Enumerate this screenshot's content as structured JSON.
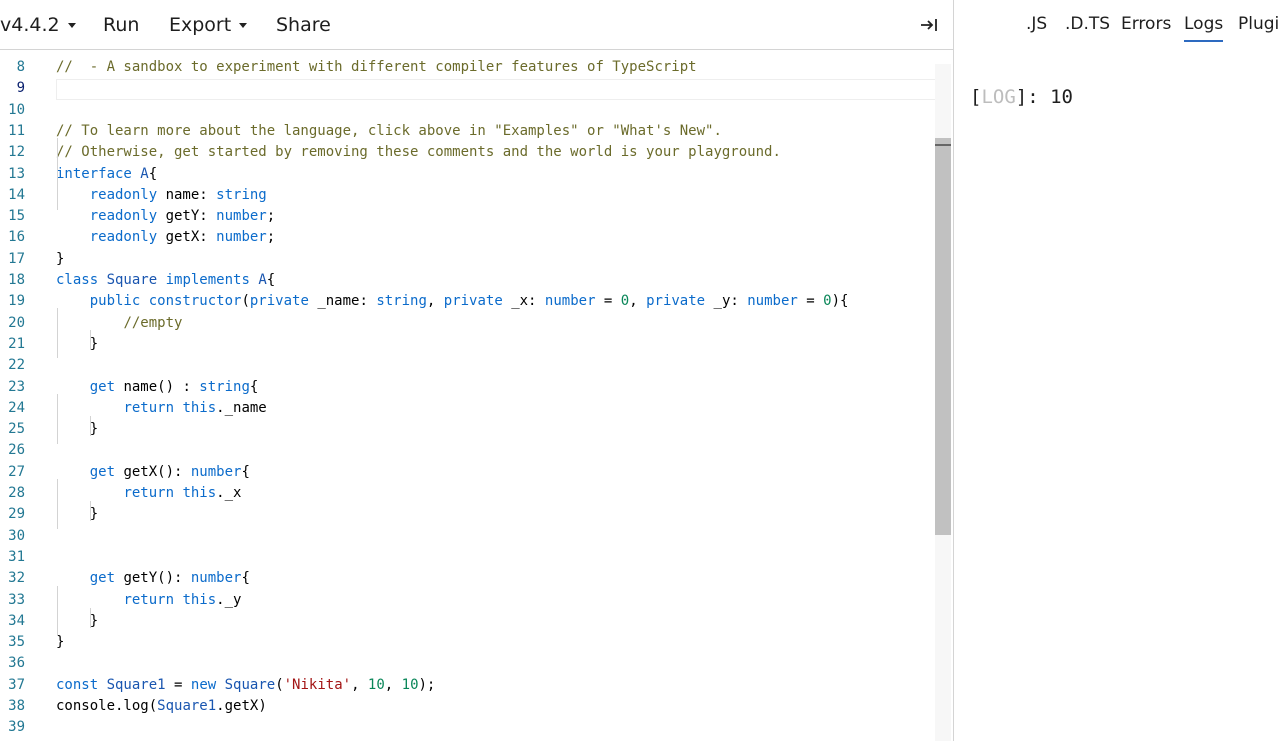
{
  "toolbar": {
    "version_label": "v4.4.2",
    "run_label": "Run",
    "export_label": "Export",
    "share_label": "Share",
    "collapse_icon": "→|"
  },
  "right_panel": {
    "tabs": [
      ".JS",
      ".D.TS",
      "Errors",
      "Logs",
      "Plugin"
    ],
    "active_tab": "Logs",
    "log": {
      "bracket_open": "[",
      "tag": "LOG",
      "bracket_close": "]",
      "value": ": 10"
    }
  },
  "editor": {
    "active_line": 9,
    "lines": [
      {
        "n": "8",
        "segs": [
          [
            "com",
            "//  - A sandbox to experiment with different compiler features of TypeScript"
          ]
        ]
      },
      {
        "n": "9",
        "segs": []
      },
      {
        "n": "10",
        "segs": []
      },
      {
        "n": "11",
        "segs": [
          [
            "com",
            "// To learn more about the language, click above in \"Examples\" or \"What's New\"."
          ]
        ]
      },
      {
        "n": "12",
        "segs": [
          [
            "com",
            "// Otherwise, get started by removing these comments and the world is your playground."
          ]
        ]
      },
      {
        "n": "13",
        "segs": [
          [
            "kw",
            "interface "
          ],
          [
            "typ",
            "A"
          ],
          [
            "fn",
            "{"
          ]
        ]
      },
      {
        "n": "14",
        "segs": [
          [
            "fn",
            "    "
          ],
          [
            "kw",
            "readonly "
          ],
          [
            "fn",
            "name: "
          ],
          [
            "kw",
            "string"
          ]
        ]
      },
      {
        "n": "15",
        "segs": [
          [
            "fn",
            "    "
          ],
          [
            "kw",
            "readonly "
          ],
          [
            "fn",
            "getY: "
          ],
          [
            "kw",
            "number"
          ],
          [
            "fn",
            ";"
          ]
        ]
      },
      {
        "n": "16",
        "segs": [
          [
            "fn",
            "    "
          ],
          [
            "kw",
            "readonly "
          ],
          [
            "fn",
            "getX: "
          ],
          [
            "kw",
            "number"
          ],
          [
            "fn",
            ";"
          ]
        ]
      },
      {
        "n": "17",
        "segs": [
          [
            "fn",
            "}"
          ]
        ]
      },
      {
        "n": "18",
        "segs": [
          [
            "kw",
            "class "
          ],
          [
            "typ",
            "Square "
          ],
          [
            "kw",
            "implements "
          ],
          [
            "typ",
            "A"
          ],
          [
            "fn",
            "{"
          ]
        ]
      },
      {
        "n": "19",
        "segs": [
          [
            "fn",
            "    "
          ],
          [
            "kw",
            "public constructor"
          ],
          [
            "fn",
            "("
          ],
          [
            "kw",
            "private "
          ],
          [
            "fn",
            "_name: "
          ],
          [
            "kw",
            "string"
          ],
          [
            "fn",
            ", "
          ],
          [
            "kw",
            "private "
          ],
          [
            "fn",
            "_x: "
          ],
          [
            "kw",
            "number"
          ],
          [
            "fn",
            " = "
          ],
          [
            "num",
            "0"
          ],
          [
            "fn",
            ", "
          ],
          [
            "kw",
            "private "
          ],
          [
            "fn",
            "_y: "
          ],
          [
            "kw",
            "number"
          ],
          [
            "fn",
            " = "
          ],
          [
            "num",
            "0"
          ],
          [
            "fn",
            "){"
          ]
        ]
      },
      {
        "n": "20",
        "segs": [
          [
            "fn",
            "        "
          ],
          [
            "com",
            "//empty"
          ]
        ]
      },
      {
        "n": "21",
        "segs": [
          [
            "fn",
            "    }"
          ]
        ]
      },
      {
        "n": "22",
        "segs": []
      },
      {
        "n": "23",
        "segs": [
          [
            "fn",
            "    "
          ],
          [
            "kw",
            "get "
          ],
          [
            "fn",
            "name() : "
          ],
          [
            "kw",
            "string"
          ],
          [
            "fn",
            "{"
          ]
        ]
      },
      {
        "n": "24",
        "segs": [
          [
            "fn",
            "        "
          ],
          [
            "kw",
            "return this"
          ],
          [
            "fn",
            "._name"
          ]
        ]
      },
      {
        "n": "25",
        "segs": [
          [
            "fn",
            "    }"
          ]
        ]
      },
      {
        "n": "26",
        "segs": []
      },
      {
        "n": "27",
        "segs": [
          [
            "fn",
            "    "
          ],
          [
            "kw",
            "get "
          ],
          [
            "fn",
            "getX(): "
          ],
          [
            "kw",
            "number"
          ],
          [
            "fn",
            "{"
          ]
        ]
      },
      {
        "n": "28",
        "segs": [
          [
            "fn",
            "        "
          ],
          [
            "kw",
            "return this"
          ],
          [
            "fn",
            "._x"
          ]
        ]
      },
      {
        "n": "29",
        "segs": [
          [
            "fn",
            "    }"
          ]
        ]
      },
      {
        "n": "30",
        "segs": []
      },
      {
        "n": "31",
        "segs": []
      },
      {
        "n": "32",
        "segs": [
          [
            "fn",
            "    "
          ],
          [
            "kw",
            "get "
          ],
          [
            "fn",
            "getY(): "
          ],
          [
            "kw",
            "number"
          ],
          [
            "fn",
            "{"
          ]
        ]
      },
      {
        "n": "33",
        "segs": [
          [
            "fn",
            "        "
          ],
          [
            "kw",
            "return this"
          ],
          [
            "fn",
            "._y"
          ]
        ]
      },
      {
        "n": "34",
        "segs": [
          [
            "fn",
            "    }"
          ]
        ]
      },
      {
        "n": "35",
        "segs": [
          [
            "fn",
            "}"
          ]
        ]
      },
      {
        "n": "36",
        "segs": []
      },
      {
        "n": "37",
        "segs": [
          [
            "kw",
            "const "
          ],
          [
            "typ",
            "Square1"
          ],
          [
            "fn",
            " = "
          ],
          [
            "kw",
            "new "
          ],
          [
            "typ",
            "Square"
          ],
          [
            "fn",
            "("
          ],
          [
            "str",
            "'Nikita'"
          ],
          [
            "fn",
            ", "
          ],
          [
            "num",
            "10"
          ],
          [
            "fn",
            ", "
          ],
          [
            "num",
            "10"
          ],
          [
            "fn",
            ");"
          ]
        ]
      },
      {
        "n": "38",
        "segs": [
          [
            "fn",
            "console.log("
          ],
          [
            "typ",
            "Square1"
          ],
          [
            "fn",
            ".getX)"
          ]
        ]
      },
      {
        "n": "39",
        "segs": []
      }
    ]
  }
}
